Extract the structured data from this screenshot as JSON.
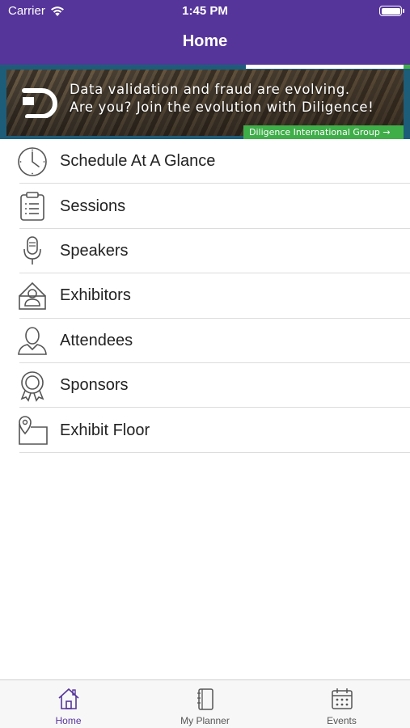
{
  "status_bar": {
    "carrier": "Carrier",
    "time": "1:45 PM"
  },
  "nav": {
    "title": "Home"
  },
  "banner": {
    "line1": "Data validation and fraud are evolving.",
    "line2": "Are you? Join the evolution with Diligence!",
    "cta": "Diligence International Group →"
  },
  "menu": {
    "items": [
      {
        "label": "Schedule At A Glance",
        "icon": "clock-icon"
      },
      {
        "label": "Sessions",
        "icon": "clipboard-icon"
      },
      {
        "label": "Speakers",
        "icon": "microphone-icon"
      },
      {
        "label": "Exhibitors",
        "icon": "exhibitor-booth-icon"
      },
      {
        "label": "Attendees",
        "icon": "person-icon"
      },
      {
        "label": "Sponsors",
        "icon": "ribbon-badge-icon"
      },
      {
        "label": "Exhibit Floor",
        "icon": "map-pin-icon"
      }
    ]
  },
  "tabbar": {
    "tabs": [
      {
        "label": "Home",
        "icon": "home-icon",
        "active": true
      },
      {
        "label": "My Planner",
        "icon": "notebook-icon",
        "active": false
      },
      {
        "label": "Events",
        "icon": "calendar-icon",
        "active": false
      }
    ]
  },
  "colors": {
    "brand_purple": "#56359a",
    "banner_green": "#3fae49",
    "banner_blue": "#1d5d7a"
  }
}
